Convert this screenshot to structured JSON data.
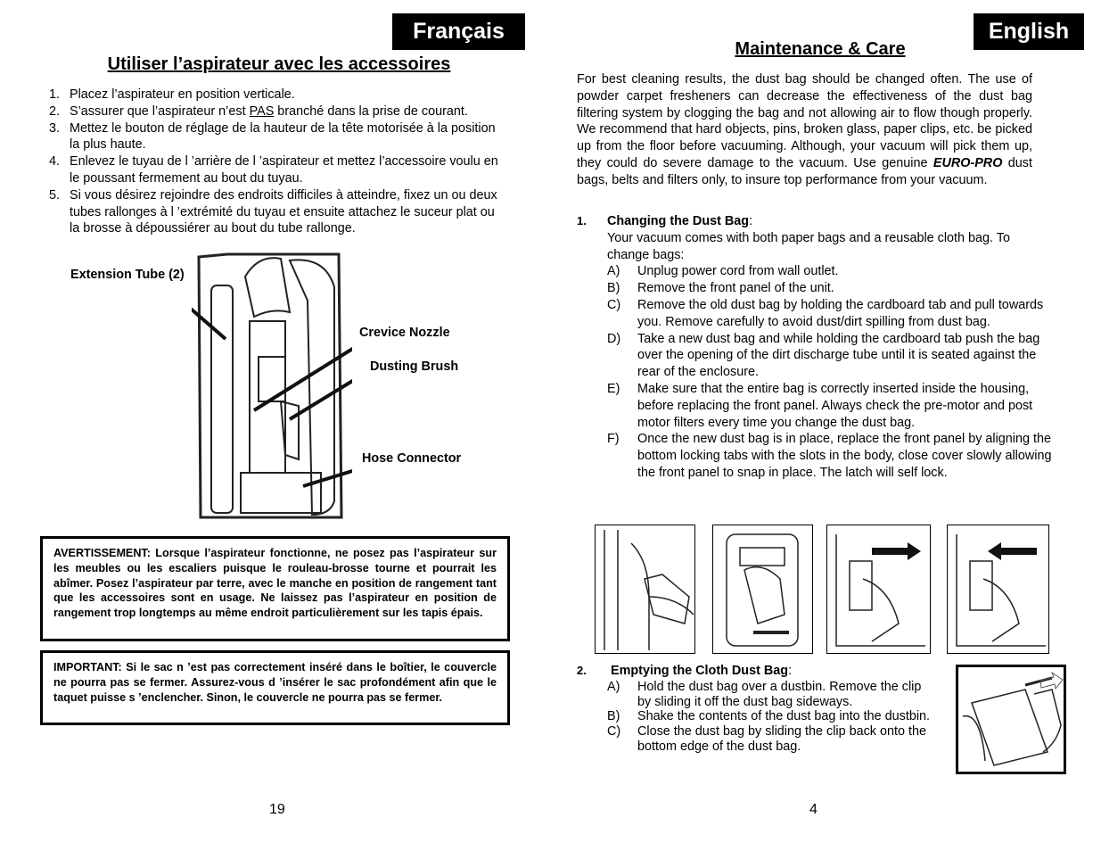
{
  "left_page": {
    "language_tab": "Français",
    "heading": "Utiliser l’aspirateur avec les accessoires",
    "steps": [
      {
        "num": "1.",
        "text": "Placez l’aspirateur en position verticale."
      },
      {
        "num": "2.",
        "text_before": "S’assurer que l’aspirateur n’est ",
        "underlined": "PAS",
        "text_after": " branché dans la prise de courant."
      },
      {
        "num": "3.",
        "text": "Mettez le bouton de réglage de la hauteur de la tête motorisée à la position la plus haute."
      },
      {
        "num": "4.",
        "text": "Enlevez le tuyau de l ’arrière de l ’aspirateur et mettez l’accessoire voulu en le poussant fermement au bout du tuyau."
      },
      {
        "num": "5.",
        "text": "Si vous désirez rejoindre des endroits difficiles à atteindre, fixez un ou deux tubes rallonges à l ’extrémité du tuyau et ensuite attachez le suceur plat ou la brosse à dépoussiérer au bout du tube rallonge."
      }
    ],
    "figure_labels": {
      "extension_tube": "Extension Tube (2)",
      "crevice_nozzle": "Crevice Nozzle",
      "dusting_brush": "Dusting Brush",
      "hose_connector": "Hose Connector"
    },
    "warning": "AVERTISSEMENT:  Lorsque l’aspirateur fonctionne, ne posez pas l’aspirateur sur les meubles ou les escaliers puisque le rouleau-brosse tourne et pourrait les abîmer.  Posez l’aspirateur par terre, avec le manche en position de rangement tant que les accessoires sont en usage.  Ne laissez pas l’aspirateur en position de rangement trop longtemps au même endroit particulièrement sur les tapis épais.",
    "important": "IMPORTANT:  Si le sac n ’est pas correctement inséré dans le boîtier, le couvercle ne pourra pas se fermer.  Assurez-vous d ’insérer le sac profondément afin que le taquet puisse s ’enclencher. Sinon, le couvercle ne pourra pas se fermer.",
    "page_number": "19"
  },
  "right_page": {
    "language_tab": "English",
    "heading": "Maintenance & Care",
    "intro_part1": "For best cleaning results, the dust bag should be changed often.  The use of powder carpet fresheners can decrease the effectiveness of the dust bag filtering system by clogging the bag and not allowing air to flow though properly.  We recommend that hard objects, pins, broken glass, paper clips, etc. be picked up from the floor before vacuuming.  Although, your vacuum will pick them up, they could do severe damage to the vacuum. Use genuine ",
    "intro_brand": "EURO-PRO",
    "intro_part2": " dust bags, belts and filters only, to insure top performance from your vacuum.",
    "section1": {
      "num": "1.",
      "title": "Changing the Dust Bag",
      "colon": ":",
      "intro": "Your vacuum comes with both paper bags and a reusable cloth bag. To change bags:",
      "items": [
        {
          "letter": "A)",
          "text": "Unplug power cord from wall outlet."
        },
        {
          "letter": "B)",
          "text": "Remove the front panel of the unit."
        },
        {
          "letter": "C)",
          "text": "Remove the old dust bag by holding the cardboard tab and pull towards you.  Remove carefully to avoid dust/dirt spilling from dust bag."
        },
        {
          "letter": "D)",
          "text": "Take a new dust bag and while holding the cardboard tab push the bag over the opening of the dirt discharge tube until it is seated against the rear of the enclosure."
        },
        {
          "letter": "E)",
          "text": "Make sure that the entire bag is correctly inserted inside the housing, before replacing the front panel. Always check the pre-motor and post motor filters every time you change the dust bag."
        },
        {
          "letter": "F)",
          "text": "Once the new dust bag is in place, replace the front panel by aligning the bottom locking tabs with the slots in the body, close cover slowly allowing the front panel to snap in place.  The latch will self lock."
        }
      ]
    },
    "section2": {
      "num": "2.",
      "title": "Emptying the Cloth Dust Bag",
      "colon": ":",
      "items": [
        {
          "letter": "A)",
          "text": "Hold the dust bag over a dustbin. Remove the clip by sliding it off the dust bag sideways."
        },
        {
          "letter": "B)",
          "text": "Shake  the contents of the dust bag into the dustbin."
        },
        {
          "letter": "C)",
          "text": "Close the dust bag by sliding the clip back onto the bottom edge of the dust bag."
        }
      ]
    },
    "page_number": "4"
  }
}
